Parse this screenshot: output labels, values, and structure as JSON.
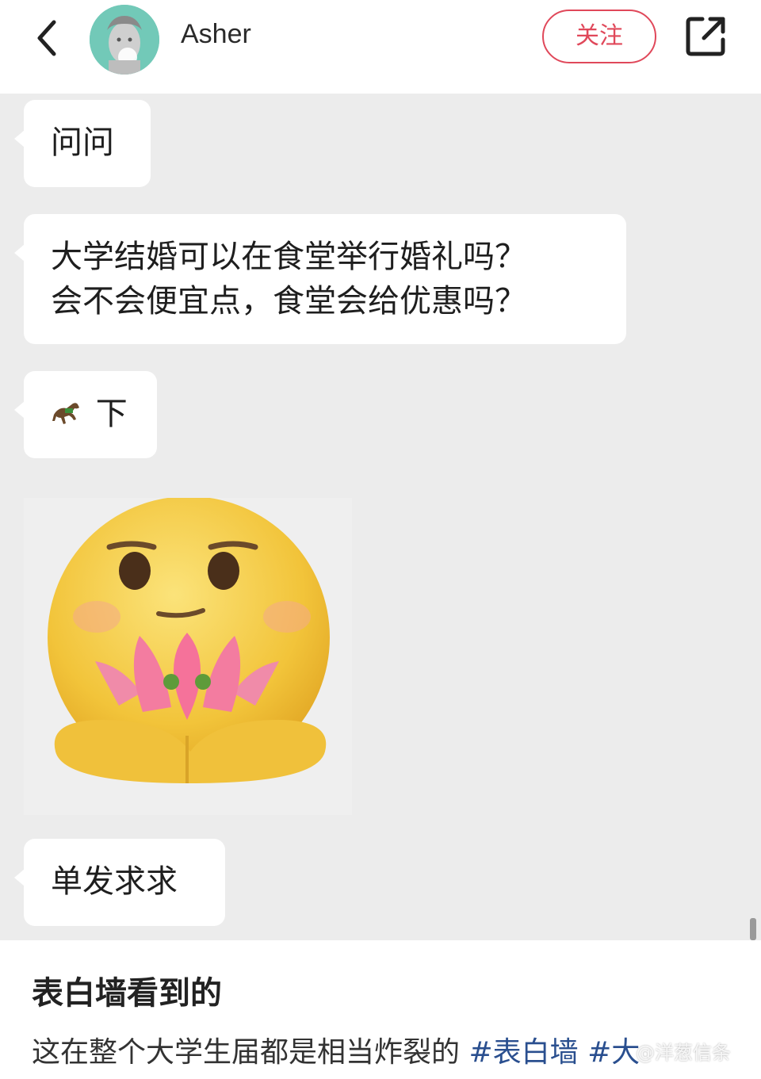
{
  "header": {
    "back_icon": "chevron-left-icon",
    "username": "Asher",
    "follow_label": "关注",
    "share_icon": "share-external-icon",
    "accent_color": "#e0485a"
  },
  "chat": {
    "messages": [
      {
        "text": "问问"
      },
      {
        "lines": [
          "大学结婚可以在食堂举行婚礼吗？",
          "会不会便宜点，食堂会给优惠吗？"
        ]
      },
      {
        "emoji": "🐎",
        "emoji_icon": "horse-emoji-icon",
        "text": "下"
      },
      {
        "sticker": "smiley-holding-lotus-sticker"
      },
      {
        "text": "单发求求"
      }
    ]
  },
  "post": {
    "title": "表白墙看到的",
    "body": "这在整个大学生届都是相当炸裂的 ",
    "tag1": "#表白墙",
    "tag2": "#大",
    "watermark": "@洋葱信条"
  }
}
